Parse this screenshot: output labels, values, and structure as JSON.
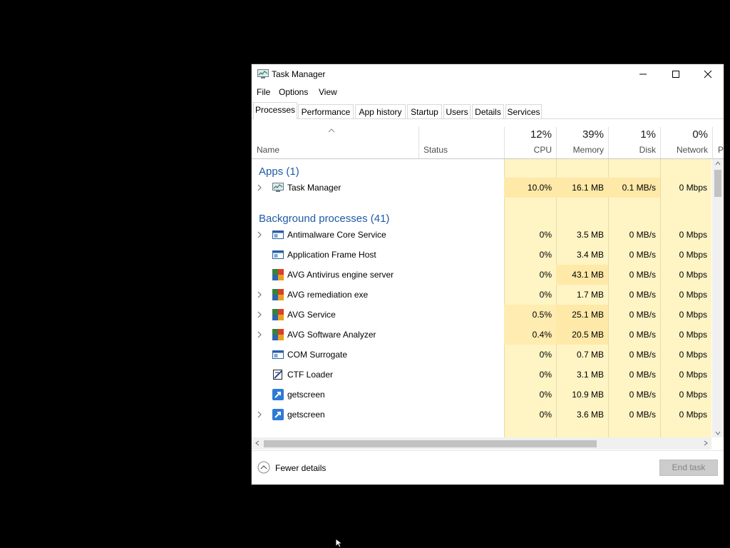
{
  "window": {
    "title": "Task Manager"
  },
  "menu": {
    "items": [
      "File",
      "Options",
      "View"
    ]
  },
  "tabs": [
    "Processes",
    "Performance",
    "App history",
    "Startup",
    "Users",
    "Details",
    "Services"
  ],
  "header": {
    "name": "Name",
    "status": "Status",
    "cpu_pct": "12%",
    "cpu": "CPU",
    "memory_pct": "39%",
    "memory": "Memory",
    "disk_pct": "1%",
    "disk": "Disk",
    "network_pct": "0%",
    "network": "Network",
    "power_partial": "P"
  },
  "groups": {
    "apps": "Apps (1)",
    "background": "Background processes (41)"
  },
  "apps_rows": [
    {
      "name": "Task Manager",
      "icon": "task-manager-icon",
      "cpu": "10.0%",
      "memory": "16.1 MB",
      "disk": "0.1 MB/s",
      "network": "0 Mbps"
    }
  ],
  "bg_rows": [
    {
      "name": "Antimalware Core Service",
      "icon": "service-window-icon",
      "cpu": "0%",
      "memory": "3.5 MB",
      "disk": "0 MB/s",
      "network": "0 Mbps"
    },
    {
      "name": "Application Frame Host",
      "icon": "service-window-icon",
      "cpu": "0%",
      "memory": "3.4 MB",
      "disk": "0 MB/s",
      "network": "0 Mbps"
    },
    {
      "name": "AVG Antivirus engine server",
      "icon": "avg-icon",
      "cpu": "0%",
      "memory": "43.1 MB",
      "disk": "0 MB/s",
      "network": "0 Mbps"
    },
    {
      "name": "AVG remediation exe",
      "icon": "avg-icon",
      "cpu": "0%",
      "memory": "1.7 MB",
      "disk": "0 MB/s",
      "network": "0 Mbps"
    },
    {
      "name": "AVG Service",
      "icon": "avg-icon",
      "cpu": "0.5%",
      "memory": "25.1 MB",
      "disk": "0 MB/s",
      "network": "0 Mbps"
    },
    {
      "name": "AVG Software Analyzer",
      "icon": "avg-icon",
      "cpu": "0.4%",
      "memory": "20.5 MB",
      "disk": "0 MB/s",
      "network": "0 Mbps"
    },
    {
      "name": "COM Surrogate",
      "icon": "service-window-icon",
      "cpu": "0%",
      "memory": "0.7 MB",
      "disk": "0 MB/s",
      "network": "0 Mbps"
    },
    {
      "name": "CTF Loader",
      "icon": "ctf-loader-icon",
      "cpu": "0%",
      "memory": "3.1 MB",
      "disk": "0 MB/s",
      "network": "0 Mbps"
    },
    {
      "name": "getscreen",
      "icon": "getscreen-icon",
      "cpu": "0%",
      "memory": "10.9 MB",
      "disk": "0 MB/s",
      "network": "0 Mbps"
    },
    {
      "name": "getscreen",
      "icon": "getscreen-icon",
      "cpu": "0%",
      "memory": "3.6 MB",
      "disk": "0 MB/s",
      "network": "0 Mbps"
    }
  ],
  "footer": {
    "fewer_details": "Fewer details",
    "end_task": "End task"
  },
  "colors": {
    "group_title": "#1e5ba8",
    "metric_bg": "#fff4c4",
    "metric_hot": "#ffe9a8"
  }
}
